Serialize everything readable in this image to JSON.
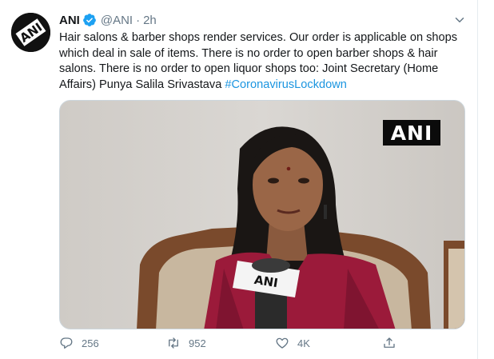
{
  "tweet": {
    "author_name": "ANI",
    "handle": "@ANI",
    "separator": "·",
    "time": "2h",
    "avatar_label": "ANI",
    "text": "Hair salons & barber shops render services. Our order is applicable on shops which deal in sale of items. There is no order to open barber shops & hair salons. There is no order to open liquor shops too: Joint Secretary (Home Affairs) Punya Salila Srivastava ",
    "hashtag": "#CoronavirusLockdown"
  },
  "media": {
    "watermark": "ANI",
    "mic_label": "ANI"
  },
  "actions": {
    "replies": "256",
    "retweets": "952",
    "likes": "4K"
  },
  "colors": {
    "link": "#1b95e0",
    "muted": "#657786",
    "verified": "#1da1f2"
  },
  "icons": {
    "verified": "verified-badge-icon",
    "caret": "chevron-down-icon",
    "reply": "reply-icon",
    "retweet": "retweet-icon",
    "like": "heart-icon",
    "share": "share-icon"
  }
}
